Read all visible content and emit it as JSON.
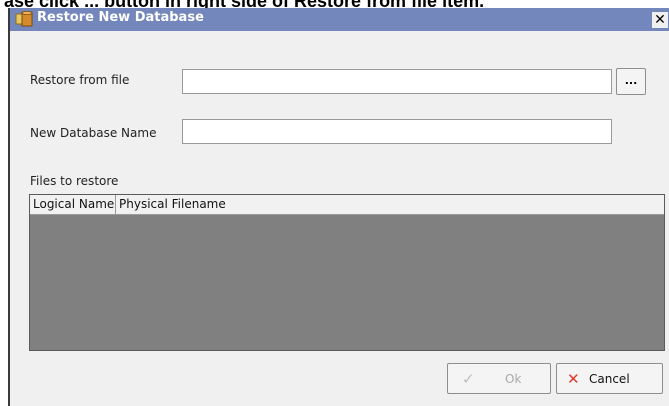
{
  "document": {
    "text_above": "ase click ... button in right side of Restore from file item."
  },
  "dialog": {
    "title": "Restore New Database",
    "close_symbol": "✕"
  },
  "form": {
    "restore_from_file_label": "Restore from file",
    "restore_from_file_value": "",
    "browse_label": "...",
    "new_db_name_label": "New Database Name",
    "new_db_name_value": "",
    "files_to_restore_label": "Files to restore"
  },
  "grid": {
    "columns": [
      "Logical Name",
      "Physical Filename"
    ],
    "rows": []
  },
  "buttons": {
    "ok_label": "Ok",
    "ok_icon": "checkmark-icon",
    "cancel_label": "Cancel",
    "cancel_icon": "x-icon"
  },
  "colors": {
    "titlebar": "#7487bc",
    "grid_body": "#808080",
    "cancel_icon": "#e03a2c"
  }
}
